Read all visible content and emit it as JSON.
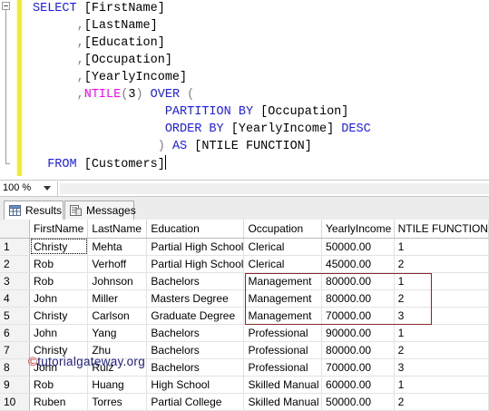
{
  "editor": {
    "lines": [
      [
        {
          "c": "kw",
          "t": "SELECT "
        },
        {
          "c": "tx",
          "t": "[FirstName]"
        }
      ],
      [
        {
          "c": "tx",
          "t": "      "
        },
        {
          "c": "gr",
          "t": ","
        },
        {
          "c": "tx",
          "t": "[LastName]"
        }
      ],
      [
        {
          "c": "tx",
          "t": "      "
        },
        {
          "c": "gr",
          "t": ","
        },
        {
          "c": "tx",
          "t": "[Education]"
        }
      ],
      [
        {
          "c": "tx",
          "t": "      "
        },
        {
          "c": "gr",
          "t": ","
        },
        {
          "c": "tx",
          "t": "[Occupation]"
        }
      ],
      [
        {
          "c": "tx",
          "t": "      "
        },
        {
          "c": "gr",
          "t": ","
        },
        {
          "c": "tx",
          "t": "[YearlyIncome]"
        }
      ],
      [
        {
          "c": "tx",
          "t": "      "
        },
        {
          "c": "gr",
          "t": ","
        },
        {
          "c": "fn",
          "t": "NTILE"
        },
        {
          "c": "gr",
          "t": "("
        },
        {
          "c": "tx",
          "t": "3"
        },
        {
          "c": "gr",
          "t": ")"
        },
        {
          "c": "kw",
          "t": " OVER "
        },
        {
          "c": "gr",
          "t": "("
        }
      ],
      [
        {
          "c": "tx",
          "t": "                  "
        },
        {
          "c": "kw",
          "t": "PARTITION BY "
        },
        {
          "c": "tx",
          "t": "[Occupation]"
        }
      ],
      [
        {
          "c": "tx",
          "t": "                  "
        },
        {
          "c": "kw",
          "t": "ORDER BY "
        },
        {
          "c": "tx",
          "t": "[YearlyIncome] "
        },
        {
          "c": "kw",
          "t": "DESC"
        }
      ],
      [
        {
          "c": "tx",
          "t": "                 "
        },
        {
          "c": "gr",
          "t": ") "
        },
        {
          "c": "kw",
          "t": "AS "
        },
        {
          "c": "tx",
          "t": "[NTILE FUNCTION]"
        }
      ],
      [
        {
          "c": "tx",
          "t": "  "
        },
        {
          "c": "kw",
          "t": "FROM "
        },
        {
          "c": "tx",
          "t": "[Customers]"
        }
      ]
    ]
  },
  "zoom": {
    "value": "100 %"
  },
  "tabs": [
    {
      "label": "Results",
      "icon": "results-grid-icon",
      "active": true
    },
    {
      "label": "Messages",
      "icon": "messages-icon",
      "active": false
    }
  ],
  "results": {
    "columns": [
      "FirstName",
      "LastName",
      "Education",
      "Occupation",
      "YearlyIncome",
      "NTILE FUNCTION"
    ],
    "rows": [
      [
        "1",
        "Christy",
        "Mehta",
        "Partial High School",
        "Clerical",
        "50000.00",
        "1"
      ],
      [
        "2",
        "Rob",
        "Verhoff",
        "Partial High School",
        "Clerical",
        "45000.00",
        "2"
      ],
      [
        "3",
        "Rob",
        "Johnson",
        "Bachelors",
        "Management",
        "80000.00",
        "1"
      ],
      [
        "4",
        "John",
        "Miller",
        "Masters Degree",
        "Management",
        "80000.00",
        "2"
      ],
      [
        "5",
        "Christy",
        "Carlson",
        "Graduate Degree",
        "Management",
        "70000.00",
        "3"
      ],
      [
        "6",
        "John",
        "Yang",
        "Bachelors",
        "Professional",
        "90000.00",
        "1"
      ],
      [
        "7",
        "Christy",
        "Zhu",
        "Bachelors",
        "Professional",
        "80000.00",
        "2"
      ],
      [
        "8",
        "John",
        "Ruiz",
        "Bachelors",
        "Professional",
        "70000.00",
        "3"
      ],
      [
        "9",
        "Rob",
        "Huang",
        "High School",
        "Skilled Manual",
        "60000.00",
        "1"
      ],
      [
        "10",
        "Ruben",
        "Torres",
        "Partial College",
        "Skilled Manual",
        "50000.00",
        "2"
      ]
    ]
  },
  "watermark": {
    "prefix": "©",
    "text": "tutorialgateway.org"
  },
  "colors": {
    "keyword": "#1a1aff",
    "function": "#ff00ff",
    "operator": "#808080",
    "highlight_box": "#8b2a2a",
    "change_bar": "#f3e92e"
  }
}
